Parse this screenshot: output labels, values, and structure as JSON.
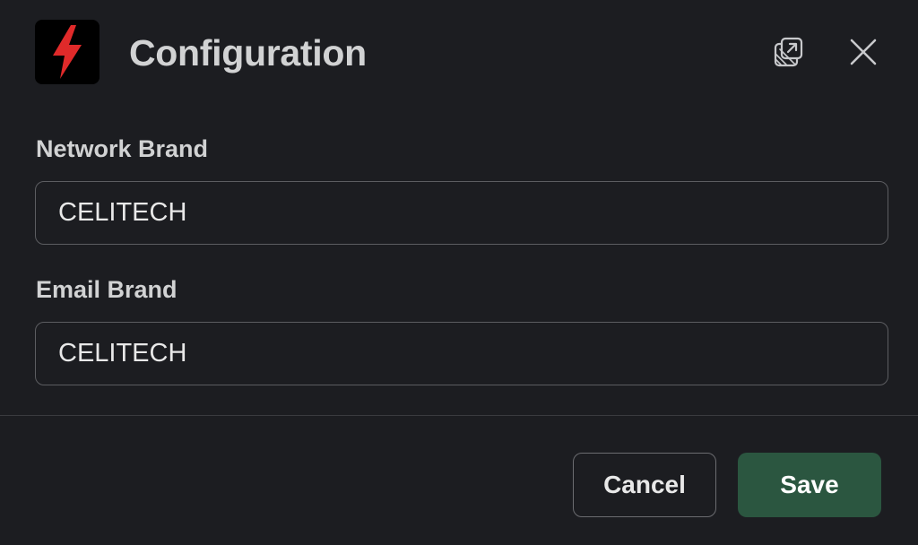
{
  "dialog": {
    "title": "Configuration",
    "logo_icon": "lightning-bolt-icon",
    "popout_icon": "open-in-new-window-icon",
    "close_icon": "close-icon"
  },
  "form": {
    "network_brand": {
      "label": "Network Brand",
      "value": "CELITECH"
    },
    "email_brand": {
      "label": "Email Brand",
      "value": "CELITECH"
    }
  },
  "footer": {
    "cancel_label": "Cancel",
    "save_label": "Save"
  },
  "colors": {
    "background": "#1c1d21",
    "accent_save": "#2b5640",
    "logo_bolt": "#e02a2a"
  }
}
